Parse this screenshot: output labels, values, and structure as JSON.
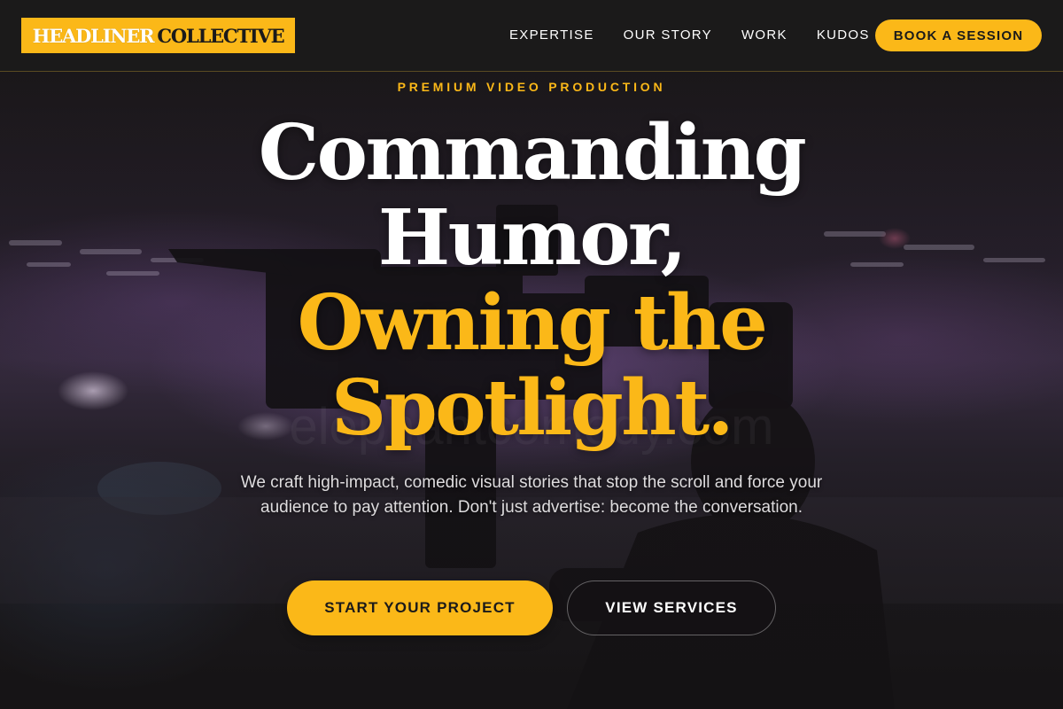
{
  "header": {
    "logo": {
      "word_1": "HEADLINER",
      "word_2": "COLLECTIVE"
    },
    "nav": [
      {
        "label": "EXPERTISE"
      },
      {
        "label": "OUR STORY"
      },
      {
        "label": "WORK"
      },
      {
        "label": "KUDOS"
      }
    ],
    "cta_label": "BOOK A SESSION"
  },
  "hero": {
    "eyebrow": "PREMIUM VIDEO PRODUCTION",
    "headline": {
      "line_1": "Commanding",
      "line_2": "Humor,",
      "line_3": "Owning the",
      "line_4": "Spotlight."
    },
    "subtext": "We craft high-impact, comedic visual stories that stop the scroll and force your audience to pay attention. Don't just advertise: become the conversation.",
    "primary_cta": "START YOUR PROJECT",
    "secondary_cta": "VIEW SERVICES",
    "background_image": "camera-operator-on-stage-photo"
  },
  "colors": {
    "accent": "#fbb818",
    "header_bg": "#1b1a1a",
    "text": "#ffffff",
    "subtext": "#dedcde"
  }
}
